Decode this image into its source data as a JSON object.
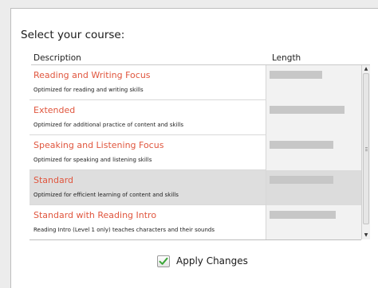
{
  "dialog": {
    "title": "Select your course:",
    "columns": {
      "description": "Description",
      "length": "Length"
    },
    "apply_label": "Apply Changes",
    "accent_color": "#e0563e"
  },
  "courses": [
    {
      "name": "Reading and Writing Focus",
      "description": "Optimized for reading and writing skills",
      "length_fraction": 0.6,
      "selected": false
    },
    {
      "name": "Extended",
      "description": "Optimized for additional practice of content and skills",
      "length_fraction": 0.85,
      "selected": false
    },
    {
      "name": "Speaking and Listening Focus",
      "description": "Optimized for speaking and listening skills",
      "length_fraction": 0.73,
      "selected": false
    },
    {
      "name": "Standard",
      "description": "Optimized for efficient learning of content and skills",
      "length_fraction": 0.73,
      "selected": true
    },
    {
      "name": "Standard with Reading Intro",
      "description": "Reading Intro (Level 1 only) teaches characters and their sounds",
      "length_fraction": 0.75,
      "selected": false
    }
  ]
}
